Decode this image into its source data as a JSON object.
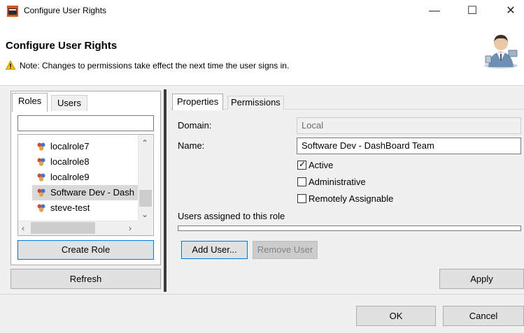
{
  "window": {
    "title": "Configure User Rights",
    "minimize_glyph": "—",
    "maximize_glyph": "☐",
    "close_glyph": "✕"
  },
  "header": {
    "title": "Configure User Rights",
    "note": "Note: Changes to permissions take effect the next time the user signs in.",
    "note_icon": "warning-icon"
  },
  "left": {
    "tabs": [
      {
        "label": "Roles",
        "active": true
      },
      {
        "label": "Users",
        "active": false
      }
    ],
    "filter_value": "",
    "roles": [
      {
        "label": "localrole7",
        "selected": false
      },
      {
        "label": "localrole8",
        "selected": false
      },
      {
        "label": "localrole9",
        "selected": false
      },
      {
        "label": "Software Dev - Dash",
        "selected": true
      },
      {
        "label": "steve-test",
        "selected": false
      }
    ],
    "create_role_label": "Create Role",
    "refresh_label": "Refresh"
  },
  "right": {
    "tabs": [
      {
        "label": "Properties",
        "active": true
      },
      {
        "label": "Permissions",
        "active": false
      }
    ],
    "domain_label": "Domain:",
    "domain_value": "Local",
    "name_label": "Name:",
    "name_value": "Software Dev - DashBoard Team",
    "checkboxes": [
      {
        "label": "Active",
        "checked": true
      },
      {
        "label": "Administrative",
        "checked": false
      },
      {
        "label": "Remotely Assignable",
        "checked": false
      }
    ],
    "users_label": "Users assigned to this role",
    "add_user_label": "Add User...",
    "remove_user_label": "Remove User",
    "apply_label": "Apply"
  },
  "footer": {
    "ok_label": "OK",
    "cancel_label": "Cancel"
  },
  "colors": {
    "accent": "#0078d7",
    "background": "#f0f0f0",
    "selection": "#d9d9d9"
  }
}
